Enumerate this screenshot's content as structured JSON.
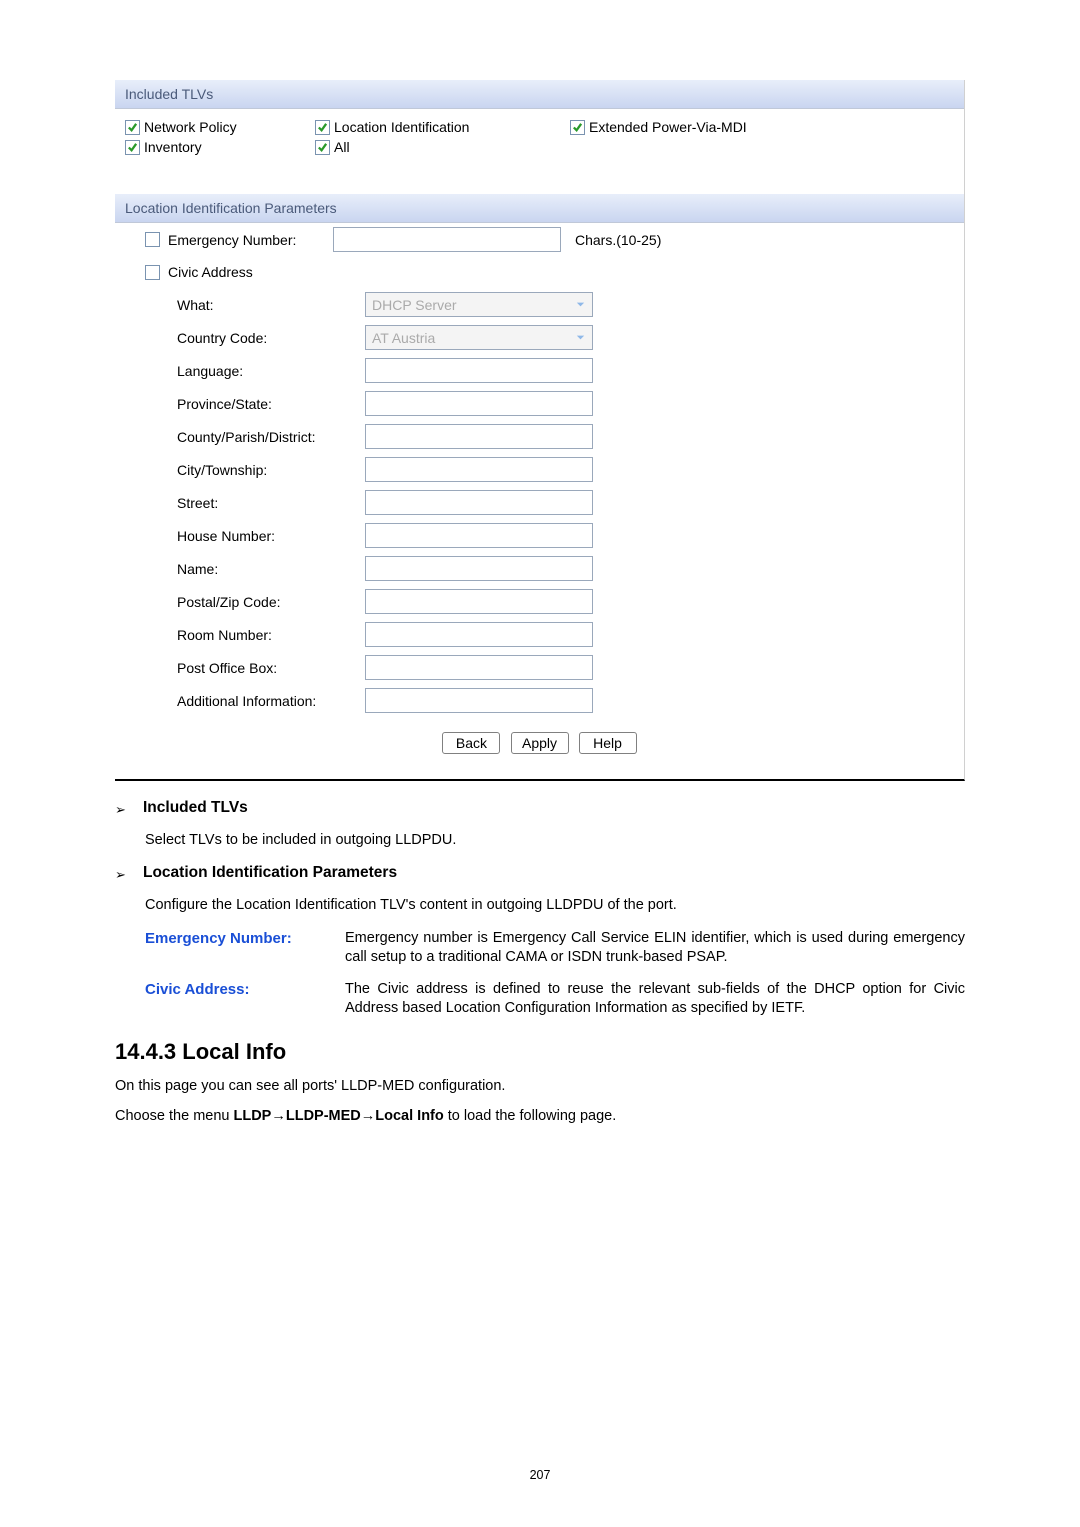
{
  "panel": {
    "tlvs_header": "Included TLVs",
    "tlvs": {
      "network_policy": {
        "label": "Network Policy",
        "checked": true
      },
      "location_id": {
        "label": "Location Identification",
        "checked": true
      },
      "ext_power": {
        "label": "Extended Power-Via-MDI",
        "checked": true
      },
      "inventory": {
        "label": "Inventory",
        "checked": true
      },
      "all": {
        "label": "All",
        "checked": true
      }
    },
    "loc_header": "Location Identification Parameters",
    "emergency": {
      "label": "Emergency Number:",
      "value": "",
      "hint": "Chars.(10-25)",
      "checked": false
    },
    "civic": {
      "label": "Civic Address",
      "checked": false
    },
    "fields": {
      "what": {
        "label": "What:",
        "value": "DHCP Server",
        "type": "select"
      },
      "country": {
        "label": "Country Code:",
        "value": "AT Austria",
        "type": "select"
      },
      "language": {
        "label": "Language:",
        "value": ""
      },
      "province": {
        "label": "Province/State:",
        "value": ""
      },
      "county": {
        "label": "County/Parish/District:",
        "value": ""
      },
      "city": {
        "label": "City/Township:",
        "value": ""
      },
      "street": {
        "label": "Street:",
        "value": ""
      },
      "house": {
        "label": "House Number:",
        "value": ""
      },
      "name": {
        "label": "Name:",
        "value": ""
      },
      "postal": {
        "label": "Postal/Zip Code:",
        "value": ""
      },
      "room": {
        "label": "Room Number:",
        "value": ""
      },
      "pobox": {
        "label": "Post Office Box:",
        "value": ""
      },
      "addl": {
        "label": "Additional Information:",
        "value": ""
      }
    },
    "buttons": {
      "back": "Back",
      "apply": "Apply",
      "help": "Help"
    }
  },
  "desc": {
    "included_title": "Included TLVs",
    "included_text": "Select TLVs to be included in outgoing LLDPDU.",
    "locparams_title": "Location Identification Parameters",
    "locparams_text": "Configure the Location Identification TLV's content in outgoing LLDPDU of the port.",
    "defs": [
      {
        "term": "Emergency Number:",
        "body": "Emergency number is Emergency Call Service ELIN identifier, which is used during emergency call setup to a traditional CAMA or ISDN trunk-based PSAP."
      },
      {
        "term": "Civic Address:",
        "body": "The Civic address is defined to reuse the relevant sub-fields of the DHCP option for Civic Address based Location Configuration Information as specified by IETF."
      }
    ]
  },
  "section": {
    "heading": "14.4.3  Local Info",
    "p1": "On this page you can see all ports' LLDP-MED configuration.",
    "p2_pre": "Choose the menu ",
    "p2_bold": "LLDP→LLDP-MED→Local Info",
    "p2_post": " to load the following page."
  },
  "pagenum": "207"
}
